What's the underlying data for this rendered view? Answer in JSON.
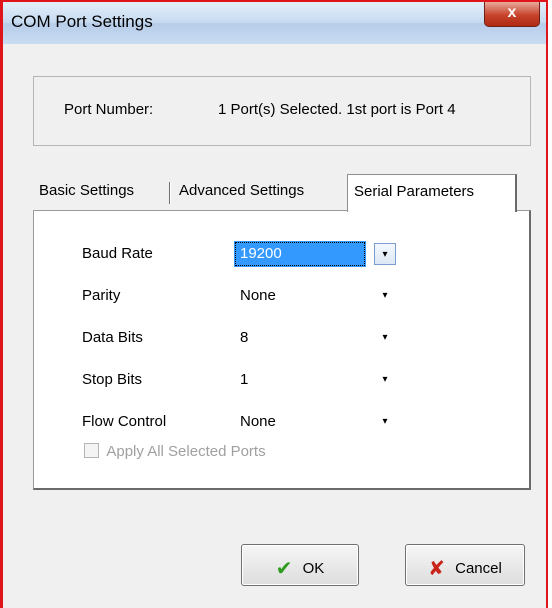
{
  "window": {
    "title": "COM Port Settings",
    "close_label": "x"
  },
  "port": {
    "label": "Port Number:",
    "value": "1 Port(s) Selected. 1st port is Port 4"
  },
  "tabs": [
    {
      "label": "Basic Settings",
      "active": false
    },
    {
      "label": "Advanced Settings",
      "active": false
    },
    {
      "label": "Serial Parameters",
      "active": true
    }
  ],
  "fields": {
    "baud_rate": {
      "label": "Baud Rate",
      "value": "19200"
    },
    "parity": {
      "label": "Parity",
      "value": "None"
    },
    "data_bits": {
      "label": "Data Bits",
      "value": "8"
    },
    "stop_bits": {
      "label": "Stop Bits",
      "value": "1"
    },
    "flow_control": {
      "label": "Flow Control",
      "value": "None"
    }
  },
  "apply_all": {
    "label": "Apply All Selected Ports",
    "checked": false,
    "enabled": false
  },
  "buttons": {
    "ok_label": "OK",
    "cancel_label": "Cancel"
  },
  "icons": {
    "arrow": "▾",
    "check": "✔",
    "cross": "✘"
  },
  "colors": {
    "window_border": "#e0151b",
    "selection": "#3399ff",
    "ok_icon": "#2e9a1e",
    "cancel_icon": "#c8241a"
  }
}
